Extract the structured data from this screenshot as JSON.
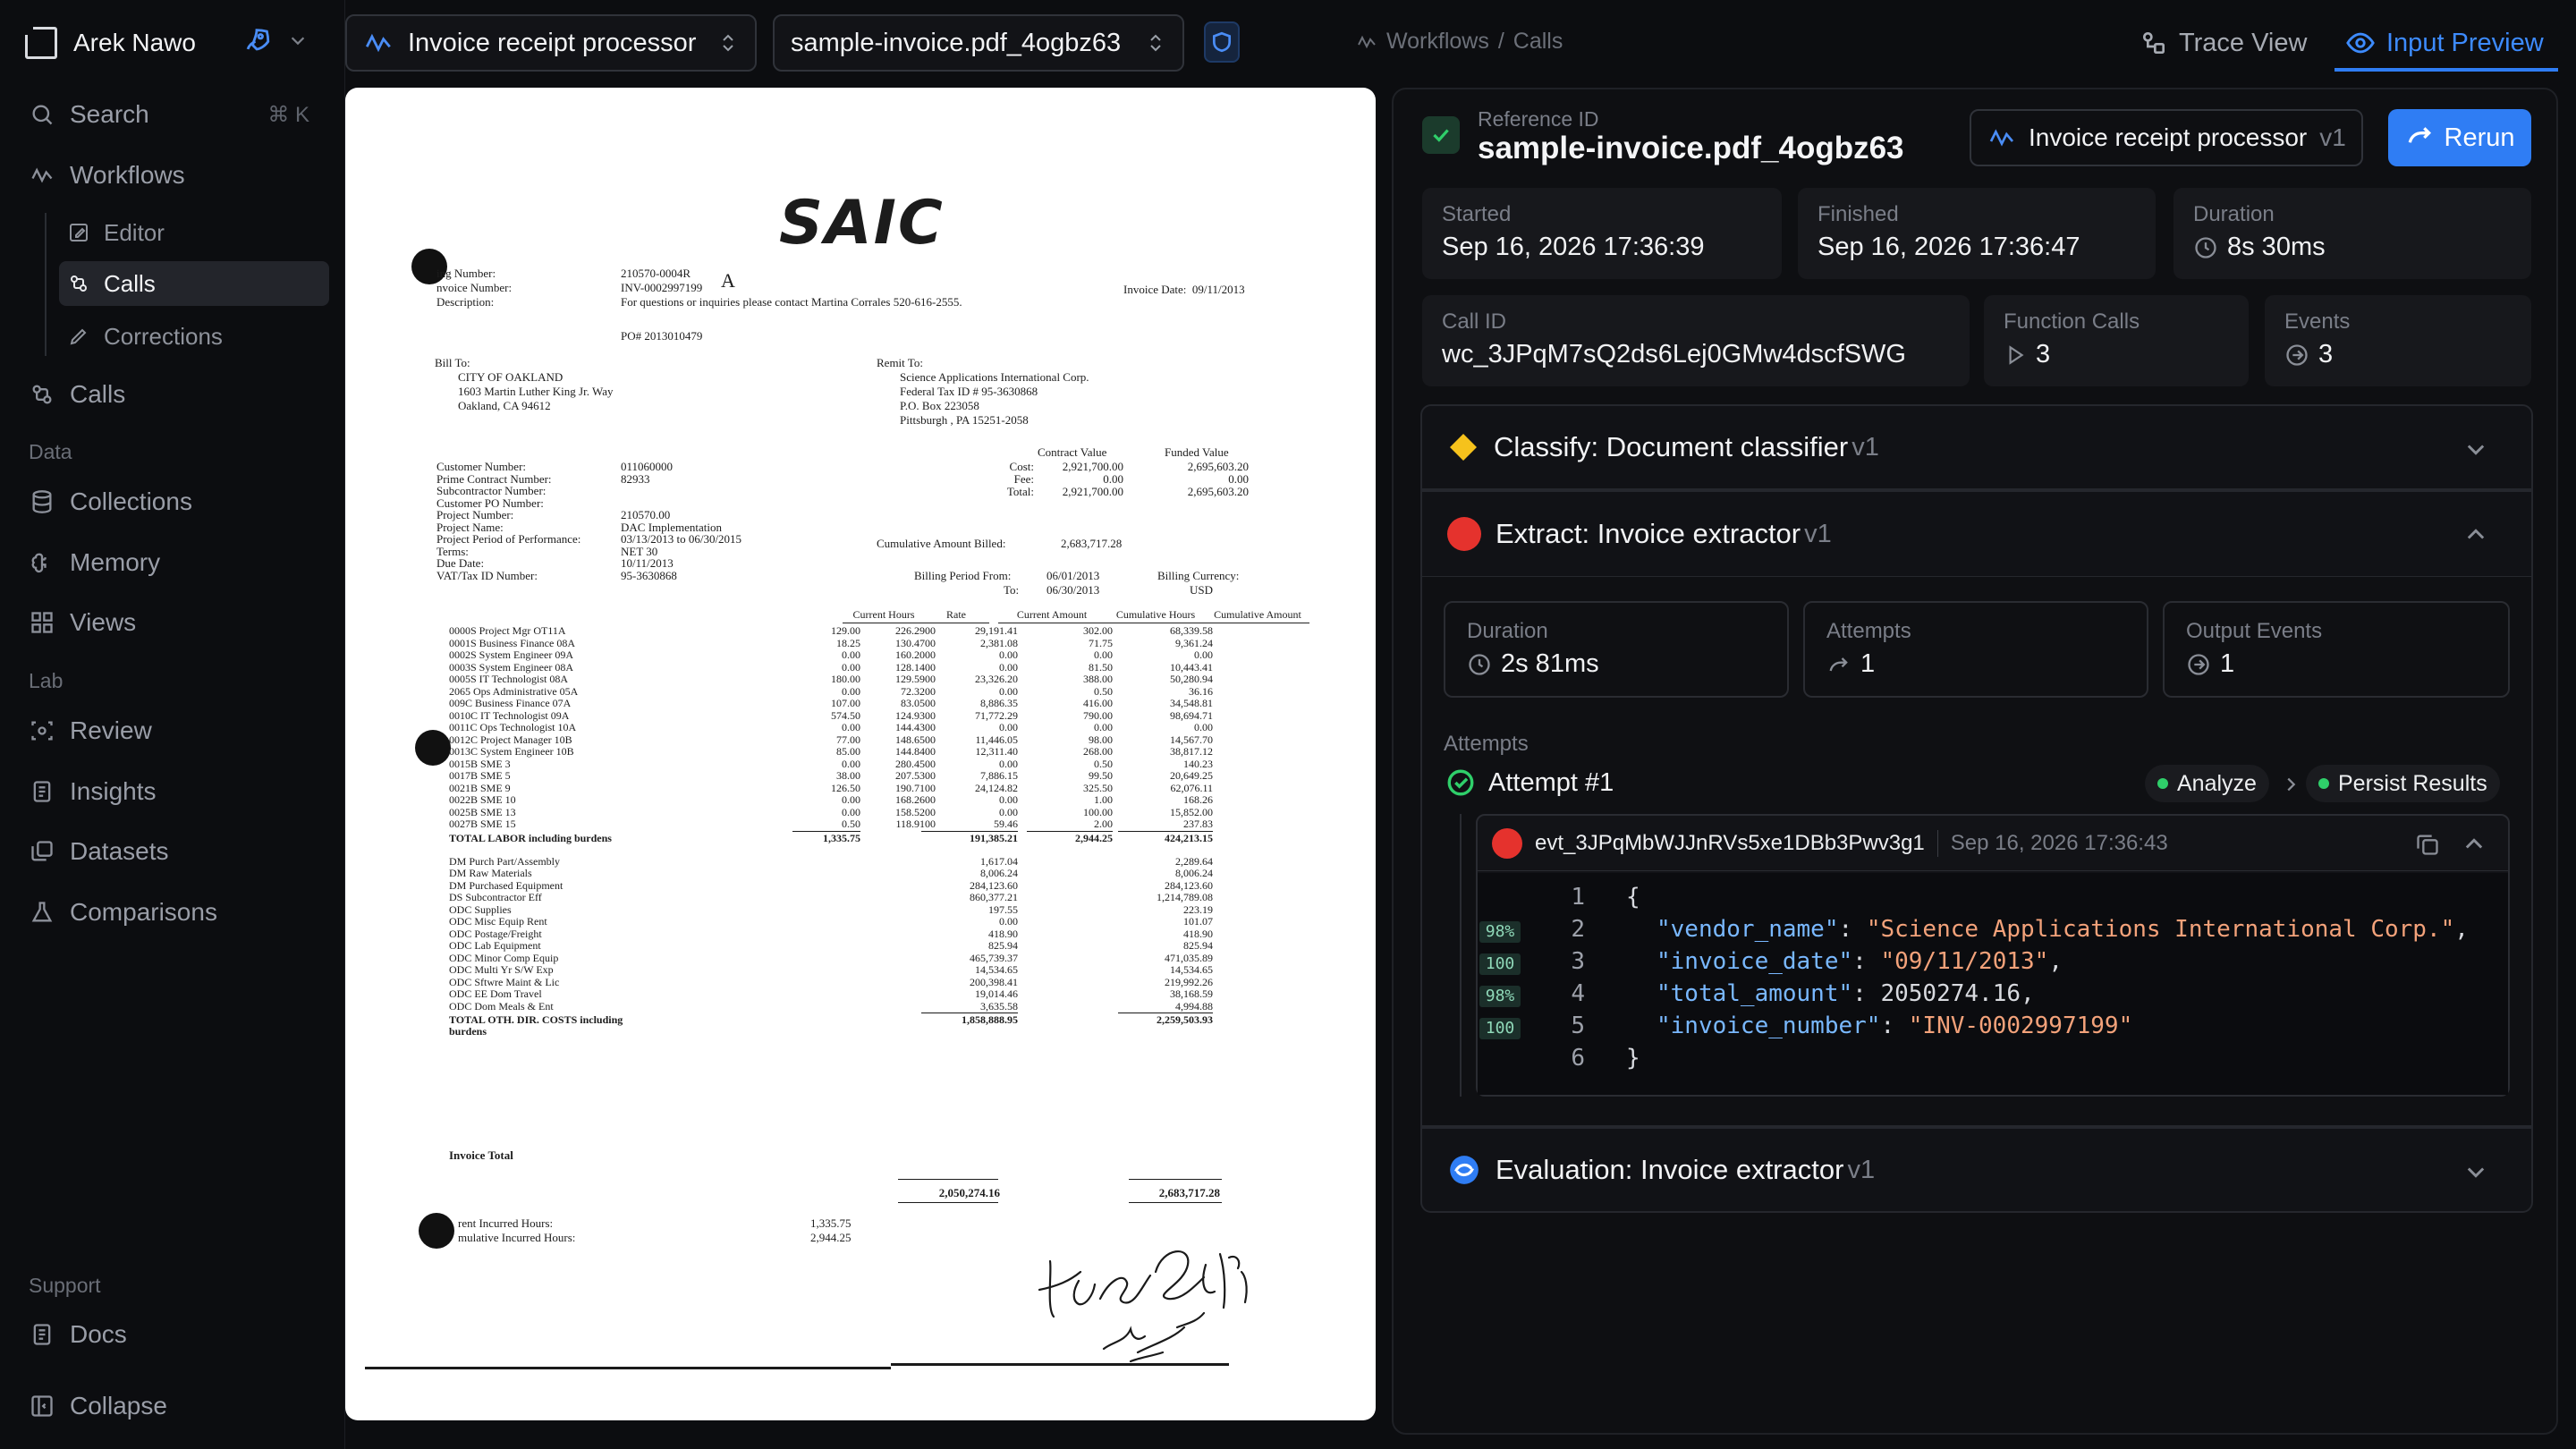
{
  "app": {
    "user_name": "Arek Nawo",
    "workflow_selector": "Invoice receipt processor",
    "file_selector": "sample-invoice.pdf_4ogbz63",
    "breadcrumb": [
      "Workflows",
      "/",
      "Calls"
    ],
    "tab_trace": "Trace View",
    "tab_input": "Input Preview",
    "accent": "#2f7df4"
  },
  "sidebar": {
    "search_label": "Search",
    "search_shortcut": "⌘ K",
    "workflows": "Workflows",
    "editor": "Editor",
    "calls_sub": "Calls",
    "corrections": "Corrections",
    "calls": "Calls",
    "section_data": "Data",
    "collections": "Collections",
    "memory": "Memory",
    "views": "Views",
    "section_lab": "Lab",
    "review": "Review",
    "insights": "Insights",
    "datasets": "Datasets",
    "comparisons": "Comparisons",
    "section_support": "Support",
    "docs": "Docs",
    "collapse": "Collapse"
  },
  "detail": {
    "ref_label": "Reference ID",
    "ref_value": "sample-invoice.pdf_4ogbz63",
    "workflow_chip": "Invoice receipt processor",
    "workflow_version": "v1",
    "rerun": "Rerun",
    "started_label": "Started",
    "started_value": "Sep 16, 2026 17:36:39",
    "finished_label": "Finished",
    "finished_value": "Sep 16, 2026 17:36:47",
    "duration_label": "Duration",
    "duration_value": "8s 30ms",
    "callid_label": "Call ID",
    "callid_value": "wc_3JPqM7sQ2ds6Lej0GMw4dscfSWG",
    "fcalls_label": "Function Calls",
    "fcalls_value": "3",
    "events_label": "Events",
    "events_value": "3"
  },
  "steps": {
    "classify": "Classify: Document classifier",
    "classify_v": "v1",
    "extract": "Extract: Invoice extractor",
    "extract_v": "v1",
    "evaluation": "Evaluation: Invoice extractor",
    "evaluation_v": "v1",
    "ex_duration_label": "Duration",
    "ex_duration_value": "2s 81ms",
    "ex_attempts_label": "Attempts",
    "ex_attempts_value": "1",
    "ex_output_label": "Output Events",
    "ex_output_value": "1",
    "attempts_heading": "Attempts",
    "attempt_title": "Attempt #1",
    "analyze": "Analyze",
    "persist": "Persist Results",
    "event_id": "evt_3JPqMbWJJnRVs5xe1DBb3Pwv3g1",
    "event_time": "Sep 16, 2026 17:36:43"
  },
  "code": {
    "line_numbers": [
      "1",
      "2",
      "3",
      "4",
      "5",
      "6"
    ],
    "confidences": [
      "98%",
      "100",
      "98%",
      "100"
    ],
    "open_brace": "{",
    "close_brace": "}",
    "k_vendor": "\"vendor_name\"",
    "v_vendor": "\"Science Applications International Corp.\"",
    "k_date": "\"invoice_date\"",
    "v_date": "\"09/11/2013\"",
    "k_total": "\"total_amount\"",
    "v_total": "2050274.16",
    "k_number": "\"invoice_number\"",
    "v_number": "\"INV-0002997199\""
  },
  "invoice": {
    "logo": "SAIC",
    "billing_number_label": "ing Number:",
    "billing_number": "210570-0004R",
    "invoice_number_label": "nvoice Number:",
    "invoice_number": "INV-0002997199",
    "description_label": "Description:",
    "description": "For questions or inquiries please contact Martina Corrales 520-616-2555.",
    "invoice_date": "Invoice Date:  09/11/2013",
    "po": "PO# 2013010479",
    "bill_to_label": "Bill To:",
    "bill_to": [
      "CITY OF OAKLAND",
      "1603 Martin Luther King Jr. Way",
      "Oakland, CA 94612"
    ],
    "remit_to_label": "Remit To:",
    "remit_to": [
      "Science Applications International Corp.",
      "Federal Tax ID # 95-3630868",
      "P.O. Box 223058",
      "Pittsburgh , PA 15251-2058"
    ],
    "info_labels": [
      "Customer Number:",
      "Prime Contract Number:",
      "Subcontractor Number:",
      "Customer PO Number:",
      "Project Number:",
      "Project Name:",
      "Project Period of Performance:",
      "Terms:",
      "Due Date:",
      "VAT/Tax ID Number:"
    ],
    "info_values": [
      "011060000",
      "82933",
      "",
      "",
      "210570.00",
      "DAC Implementation",
      "03/13/2013 to 06/30/2015",
      "NET 30",
      "10/11/2013",
      "95-3630868"
    ],
    "contract_value_label": "Contract Value",
    "funded_value_label": "Funded Value",
    "cost_labels": [
      "Cost:",
      "Fee:",
      "Total:"
    ],
    "contract_values": [
      "2,921,700.00",
      "0.00",
      "2,921,700.00"
    ],
    "funded_values": [
      "2,695,603.20",
      "0.00",
      "2,695,603.20"
    ],
    "cum_billed_label": "Cumulative Amount Billed:",
    "cum_billed": "2,683,717.28",
    "billing_period_label": "Billing Period From:",
    "billing_period_from": "06/01/2013",
    "billing_period_to_label": "To:",
    "billing_period_to": "06/30/2013",
    "billing_currency_label": "Billing Currency:",
    "billing_currency": "USD",
    "col_headers": [
      "Current Hours",
      "Rate",
      "Current Amount",
      "Cumulative Hours",
      "Cumulative Amount"
    ],
    "labor_rows": [
      [
        "0000S Project Mgr OT11A",
        "129.00",
        "226.2900",
        "29,191.41",
        "302.00",
        "68,339.58"
      ],
      [
        "0001S Business Finance 08A",
        "18.25",
        "130.4700",
        "2,381.08",
        "71.75",
        "9,361.24"
      ],
      [
        "0002S System Engineer 09A",
        "0.00",
        "160.2000",
        "0.00",
        "0.00",
        "0.00"
      ],
      [
        "0003S System Engineer 08A",
        "0.00",
        "128.1400",
        "0.00",
        "81.50",
        "10,443.41"
      ],
      [
        "0005S IT Technologist 08A",
        "180.00",
        "129.5900",
        "23,326.20",
        "388.00",
        "50,280.94"
      ],
      [
        "2065 Ops Administrative 05A",
        "0.00",
        "72.3200",
        "0.00",
        "0.50",
        "36.16"
      ],
      [
        "009C Business Finance 07A",
        "107.00",
        "83.0500",
        "8,886.35",
        "416.00",
        "34,548.81"
      ],
      [
        "0010C IT Technologist 09A",
        "574.50",
        "124.9300",
        "71,772.29",
        "790.00",
        "98,694.71"
      ],
      [
        "0011C Ops Technologist 10A",
        "0.00",
        "144.4300",
        "0.00",
        "0.00",
        "0.00"
      ],
      [
        "0012C Project Manager 10B",
        "77.00",
        "148.6500",
        "11,446.05",
        "98.00",
        "14,567.70"
      ],
      [
        "0013C System Engineer 10B",
        "85.00",
        "144.8400",
        "12,311.40",
        "268.00",
        "38,817.12"
      ],
      [
        "0015B SME 3",
        "0.00",
        "280.4500",
        "0.00",
        "0.50",
        "140.23"
      ],
      [
        "0017B SME 5",
        "38.00",
        "207.5300",
        "7,886.15",
        "99.50",
        "20,649.25"
      ],
      [
        "0021B SME 9",
        "126.50",
        "190.7100",
        "24,124.82",
        "325.50",
        "62,076.11"
      ],
      [
        "0022B SME 10",
        "0.00",
        "168.2600",
        "0.00",
        "1.00",
        "168.26"
      ],
      [
        "0025B SME 13",
        "0.00",
        "158.5200",
        "0.00",
        "100.00",
        "15,852.00"
      ],
      [
        "0027B SME 15",
        "0.50",
        "118.9100",
        "59.46",
        "2.00",
        "237.83"
      ]
    ],
    "labor_total": [
      "TOTAL LABOR including burdens",
      "1,335.75",
      "",
      "191,385.21",
      "2,944.25",
      "424,213.15"
    ],
    "other_rows": [
      [
        "DM Purch Part/Assembly",
        "1,617.04",
        "2,289.64"
      ],
      [
        "DM Raw Materials",
        "8,006.24",
        "8,006.24"
      ],
      [
        "DM Purchased Equipment",
        "284,123.60",
        "284,123.60"
      ],
      [
        "DS Subcontractor Eff",
        "860,377.21",
        "1,214,789.08"
      ],
      [
        "ODC Supplies",
        "197.55",
        "223.19"
      ],
      [
        "ODC Misc Equip Rent",
        "0.00",
        "101.07"
      ],
      [
        "ODC Postage/Freight",
        "418.90",
        "418.90"
      ],
      [
        "ODC Lab Equipment",
        "825.94",
        "825.94"
      ],
      [
        "ODC Minor Comp Equip",
        "465,739.37",
        "471,035.89"
      ],
      [
        "ODC Multi Yr S/W Exp",
        "14,534.65",
        "14,534.65"
      ],
      [
        "ODC Sftwre Maint & Lic",
        "200,398.41",
        "219,992.26"
      ],
      [
        "ODC EE Dom Travel",
        "19,014.46",
        "38,168.59"
      ],
      [
        "ODC Dom Meals & Ent",
        "3,635.58",
        "4,994.88"
      ]
    ],
    "other_total_label": [
      "TOTAL OTH. DIR. COSTS including",
      "burdens"
    ],
    "other_total_current": "1,858,888.95",
    "other_total_cum": "2,259,503.93",
    "invoice_total_label": "Invoice Total",
    "invoice_total_current": "2,050,274.16",
    "invoice_total_cum": "2,683,717.28",
    "hours_labels": [
      "rent Incurred Hours:",
      "mulative Incurred Hours:"
    ],
    "hours_values": [
      "1,335.75",
      "2,944.25"
    ],
    "handwritten_a": "A"
  }
}
